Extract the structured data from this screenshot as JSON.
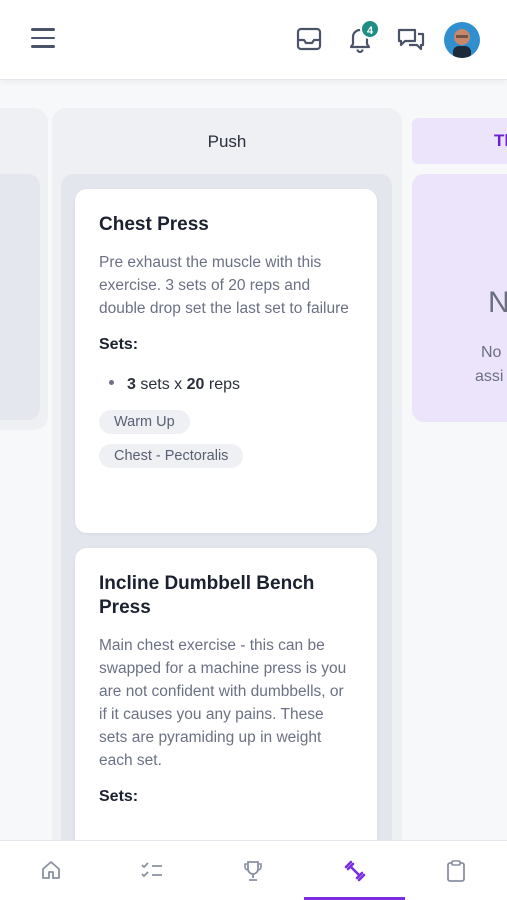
{
  "header": {
    "notification_count": "4",
    "icons": [
      "menu-icon",
      "inbox-icon",
      "bell-icon",
      "chat-icon",
      "avatar"
    ]
  },
  "columns": {
    "push": {
      "title": "Push"
    },
    "right": {
      "title": "Th",
      "big_text": "N",
      "line1": "No",
      "line2": "assi"
    }
  },
  "cards": [
    {
      "title": "Chest Press",
      "description": "Pre exhaust the muscle with this exercise. 3 sets of 20 reps and double drop set the last set to failure",
      "sets_label": "Sets:",
      "sets": {
        "count": "3",
        "sets_word": "sets x",
        "reps": "20",
        "reps_word": "reps"
      },
      "tags": [
        "Warm Up",
        "Chest - Pectoralis"
      ]
    },
    {
      "title": "Incline Dumbbell Bench Press",
      "description": "Main chest exercise - this can be swapped for a machine press is you are not confident with dumbbells, or if it causes you any pains. These sets are pyramiding up in weight each set.",
      "sets_label": "Sets:"
    }
  ],
  "bottom_nav": {
    "items": [
      "home-icon",
      "checklist-icon",
      "trophy-icon",
      "workout-icon",
      "clipboard-icon"
    ],
    "active_index": 3,
    "active_color": "#7a2ee0"
  },
  "colors": {
    "accent": "#7a2ee0",
    "badge": "#1f8f86",
    "right_column_bg": "#ece4fb"
  }
}
